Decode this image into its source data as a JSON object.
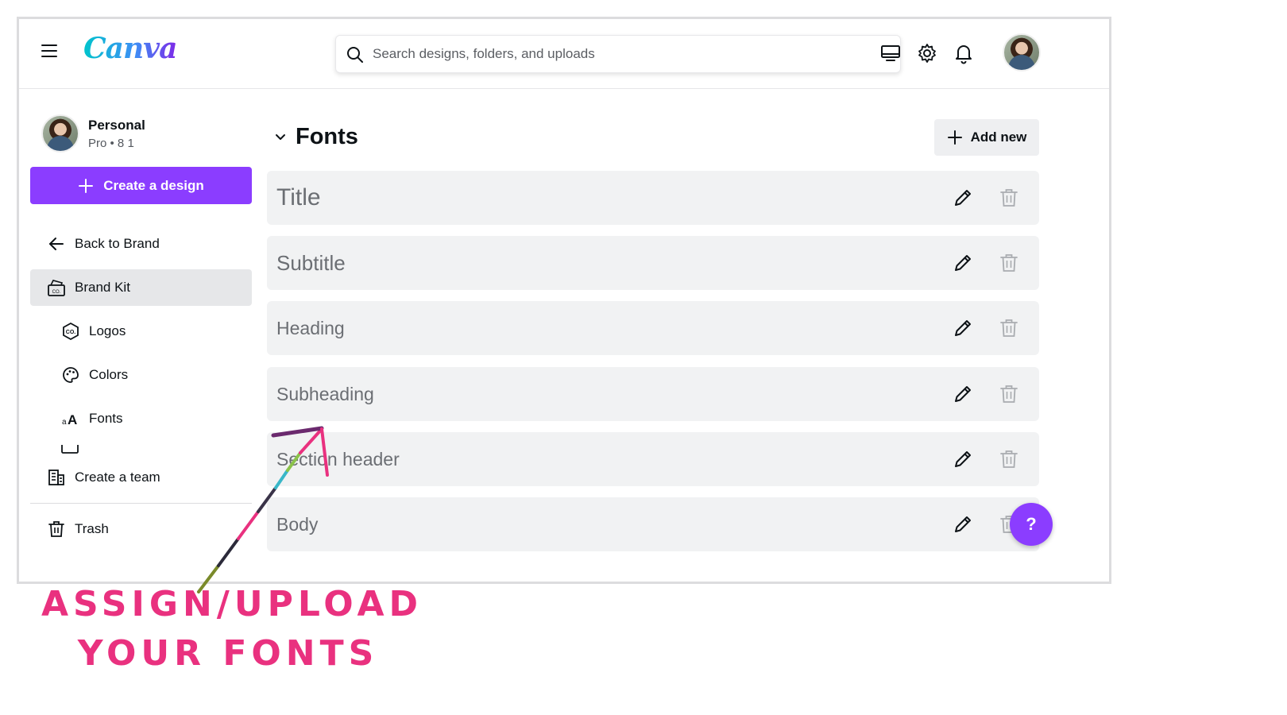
{
  "topbar": {
    "logo": "Canva",
    "search_placeholder": "Search designs, folders, and uploads"
  },
  "account": {
    "name": "Personal",
    "plan": "Pro • 8 1"
  },
  "sidebar": {
    "create_label": "Create a design",
    "items": [
      {
        "label": "Back to Brand",
        "icon": "arrow-left-icon"
      },
      {
        "label": "Brand Kit",
        "icon": "brand-kit-icon"
      },
      {
        "label": "Logos",
        "icon": "logo-icon"
      },
      {
        "label": "Colors",
        "icon": "palette-icon"
      },
      {
        "label": "Fonts",
        "icon": "fonts-icon"
      },
      {
        "label": "Create a team",
        "icon": "building-icon"
      },
      {
        "label": "Trash",
        "icon": "trash-icon"
      }
    ]
  },
  "main": {
    "title": "Fonts",
    "add_label": "Add new",
    "rows": [
      {
        "label": "Title"
      },
      {
        "label": "Subtitle"
      },
      {
        "label": "Heading"
      },
      {
        "label": "Subheading"
      },
      {
        "label": "Section header"
      },
      {
        "label": "Body"
      }
    ]
  },
  "help": {
    "label": "?"
  },
  "annotation": {
    "line1": "ASSIGN/UPLOAD",
    "line2": "YOUR FONTS",
    "color": "#e9317f"
  },
  "colors": {
    "accent": "#8b3dff",
    "row_bg": "#f1f2f3"
  }
}
